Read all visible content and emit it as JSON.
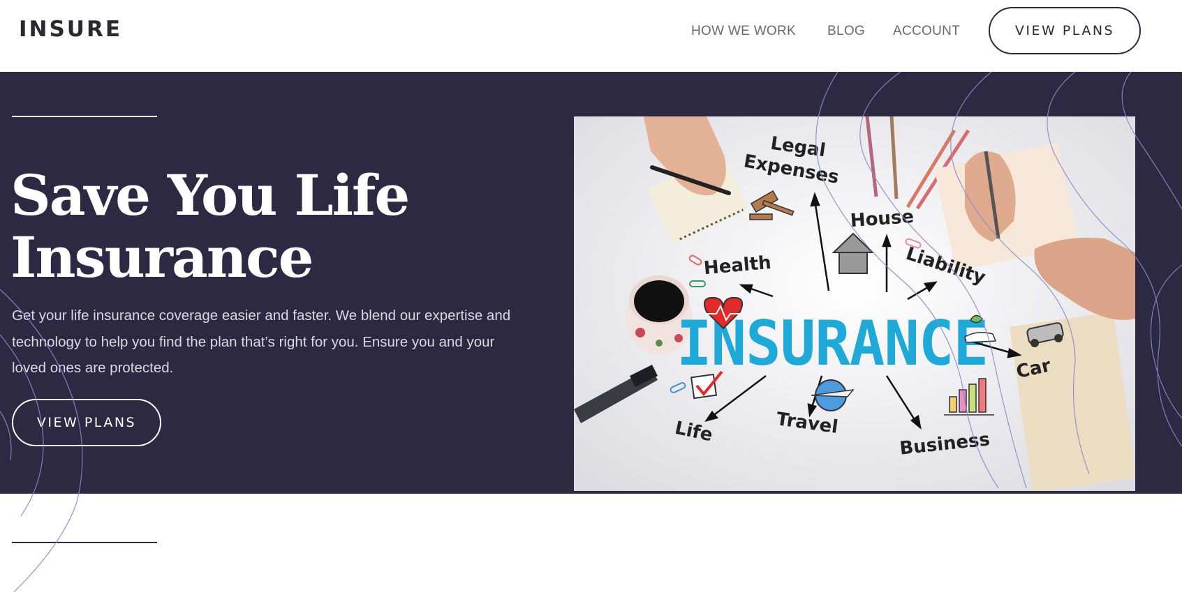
{
  "header": {
    "logo": "INSURE",
    "nav": [
      {
        "label": "HOW WE WORK"
      },
      {
        "label": "BLOG"
      },
      {
        "label": "ACCOUNT"
      }
    ],
    "cta_label": "VIEW PLANS"
  },
  "hero": {
    "title_line1": "Save You Life",
    "title_line2": "Insurance",
    "description_line1": "Get your life insurance coverage easier and faster. We blend our expertise and",
    "description_line2": "technology to help you find the plan that’s right for you. Ensure you and your",
    "description_line3": "loved ones are protected.",
    "cta_label": "VIEW PLANS"
  },
  "image": {
    "center_word": "INSURANCE",
    "labels": {
      "legal": "Legal",
      "expenses": "Expenses",
      "house": "House",
      "health": "Health",
      "liability": "Liability",
      "car": "Car",
      "life": "Life",
      "travel": "Travel",
      "business": "Business"
    }
  },
  "colors": {
    "hero_bg": "#2e2942",
    "dark": "#2d283e",
    "accent": "#1fa9d8"
  }
}
